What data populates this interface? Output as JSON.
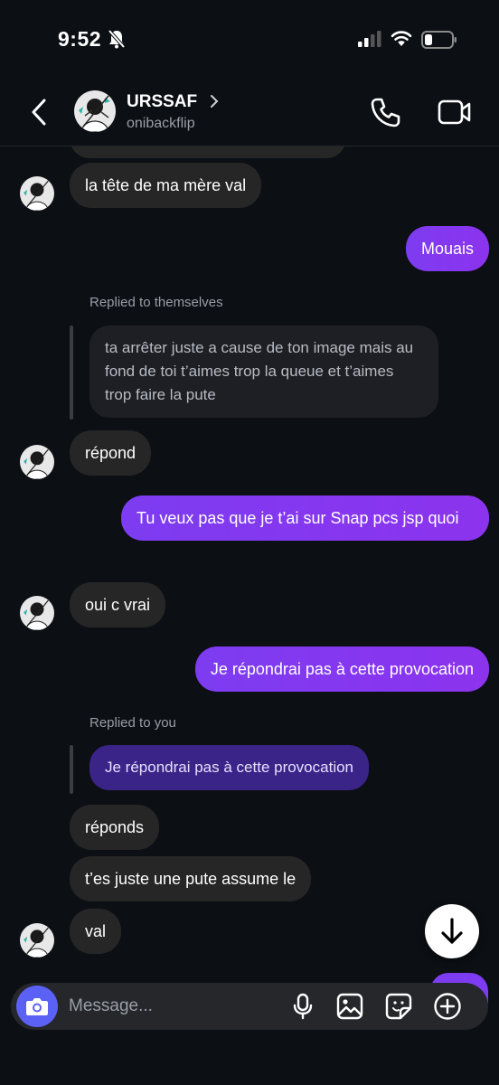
{
  "status_bar": {
    "time": "9:52"
  },
  "header": {
    "contact_name": "URSSAF",
    "username": "onibackflip"
  },
  "messages": {
    "m1": "la tête de ma mère val",
    "m2": "Mouais",
    "reply1_label": "Replied to themselves",
    "reply1_quote": "ta arrêter juste a cause de ton image mais au fond de toi t’aimes trop la queue et t’aimes trop faire la pute",
    "m3": "répond",
    "m4": "Tu veux pas que je t’ai sur Snap pcs jsp quoi",
    "m5": "oui c vrai",
    "m6": "Je répondrai pas à cette provocation",
    "reply2_label": "Replied to you",
    "reply2_quote": "Je répondrai pas à cette provocation",
    "m7": "réponds",
    "m8": "t’es juste une pute assume le",
    "m9": "val"
  },
  "composer": {
    "placeholder": "Message..."
  },
  "colors": {
    "background": "#0c0f14",
    "received_bubble": "#262626",
    "sent_bubble": "#7d3cf1",
    "quoted_sent": "#3b2488",
    "camera_button": "#5b61f5"
  },
  "icons": [
    "bell-slash-icon",
    "cellular-signal-icon",
    "wifi-icon",
    "battery-icon",
    "back-chevron-icon",
    "chevron-right-icon",
    "phone-icon",
    "video-camera-icon",
    "arrow-down-icon",
    "camera-icon",
    "microphone-icon",
    "image-icon",
    "sticker-icon",
    "plus-icon"
  ]
}
